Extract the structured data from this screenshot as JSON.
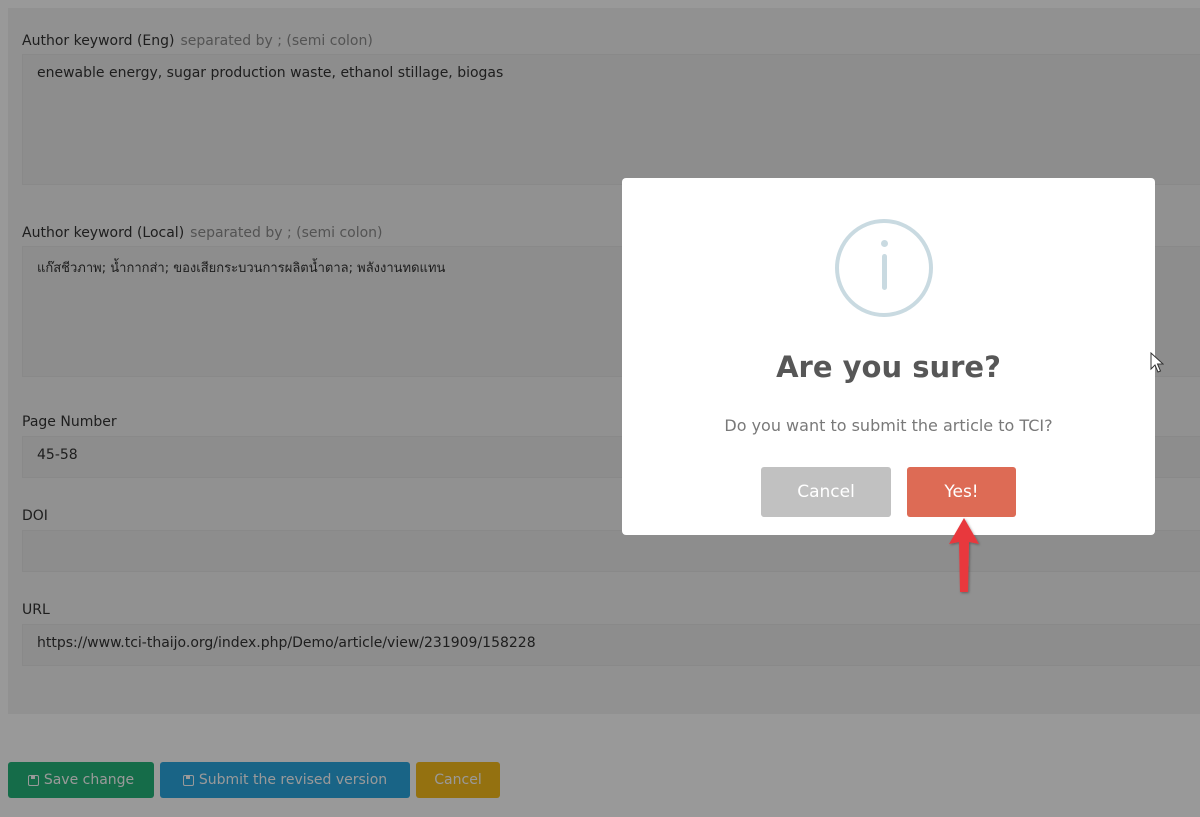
{
  "form": {
    "kw_eng": {
      "label": "Author keyword (Eng)",
      "hint": "separated by ; (semi colon)",
      "value": "enewable energy, sugar production waste, ethanol stillage, biogas"
    },
    "kw_local": {
      "label": "Author keyword (Local)",
      "hint": "separated by ; (semi colon)",
      "value": "แก๊สชีวภาพ; น้ำกากส่า; ของเสียกระบวนการผลิตน้ำตาล; พลังงานทดแทน"
    },
    "page_number": {
      "label": "Page Number",
      "value": "45-58"
    },
    "doi": {
      "label": "DOI",
      "value": ""
    },
    "url": {
      "label": "URL",
      "value": "https://www.tci-thaijo.org/index.php/Demo/article/view/231909/158228"
    }
  },
  "actions": {
    "save_label": "Save change",
    "submit_label": "Submit the revised version",
    "cancel_label": "Cancel"
  },
  "dialog": {
    "icon": "info-icon",
    "title": "Are you sure?",
    "text": "Do you want to submit the article to TCI?",
    "cancel_label": "Cancel",
    "confirm_label": "Yes!"
  },
  "colors": {
    "save": "#23b57a",
    "submit": "#2aa7e0",
    "cancel_yellow": "#f7bc1c",
    "dialog_cancel": "#c1c1c1",
    "dialog_confirm": "#dd6b55",
    "annotation_arrow": "#e8383d"
  }
}
